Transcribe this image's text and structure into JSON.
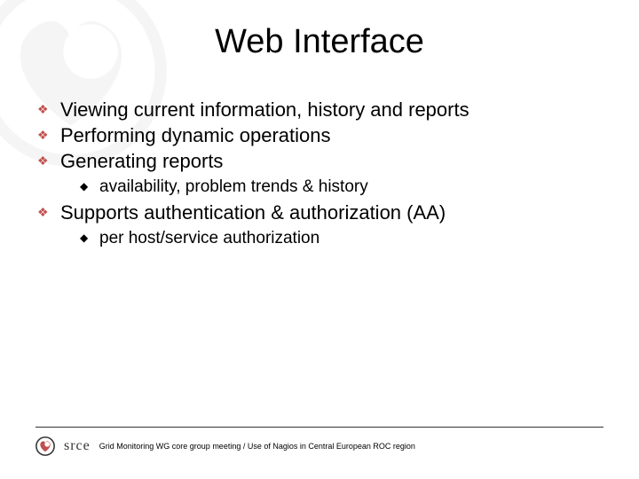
{
  "title": "Web Interface",
  "bullets": [
    {
      "text": "Viewing current information, history and reports",
      "subs": []
    },
    {
      "text": "Performing dynamic operations",
      "subs": []
    },
    {
      "text": "Generating reports",
      "subs": [
        "availability, problem trends & history"
      ]
    },
    {
      "text": "Supports authentication & authorization (AA)",
      "subs": [
        "per host/service authorization"
      ]
    }
  ],
  "footer": {
    "brand": "srce",
    "text": "Grid Monitoring WG core group meeting / Use of Nagios in Central European ROC region"
  },
  "glyphs": {
    "diamond": "❖",
    "dot": "◆"
  }
}
